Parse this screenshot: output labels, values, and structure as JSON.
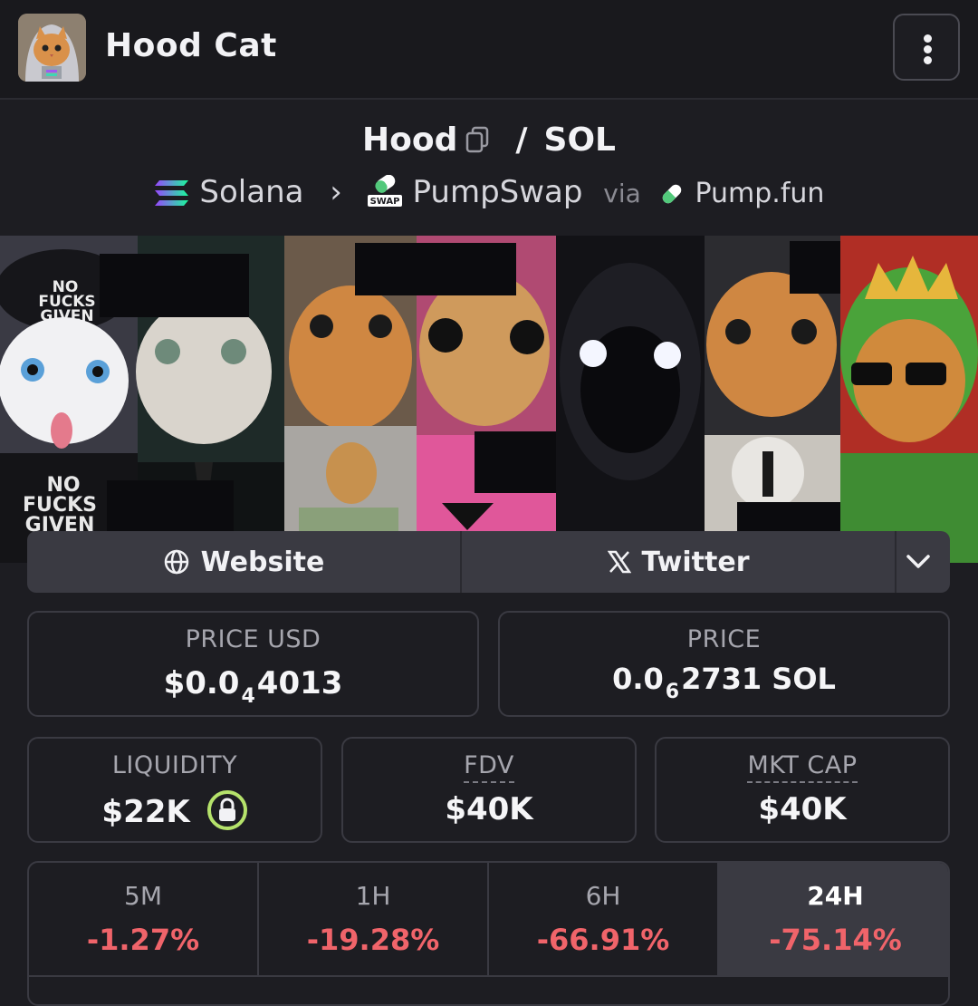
{
  "header": {
    "title": "Hood Cat"
  },
  "pair": {
    "base": "Hood",
    "separator": "/",
    "quote": "SOL"
  },
  "route": {
    "chain": "Solana",
    "dex": "PumpSwap",
    "via": "via",
    "launchpad": "Pump.fun",
    "swap_badge": "SWAP"
  },
  "banner": {
    "cap1_top": "NO",
    "cap1_mid": "FUCKS",
    "cap1_bot": "GIVEN",
    "shirt_top": "NO",
    "shirt_mid": "FUCKS",
    "shirt_bot": "GIVEN"
  },
  "links": {
    "website": "Website",
    "twitter": "Twitter"
  },
  "stats": {
    "price_usd": {
      "label": "PRICE USD",
      "prefix": "$0.0",
      "zeros": "4",
      "digits": "4013"
    },
    "price_sol": {
      "label": "PRICE",
      "prefix": "0.0",
      "zeros": "6",
      "digits": "2731 SOL"
    },
    "liquidity": {
      "label": "LIQUIDITY",
      "value": "$22K"
    },
    "fdv": {
      "label": "FDV",
      "value": "$40K"
    },
    "mkt_cap": {
      "label": "MKT CAP",
      "value": "$40K"
    }
  },
  "changes": [
    {
      "label": "5M",
      "value": "-1.27%"
    },
    {
      "label": "1H",
      "value": "-19.28%"
    },
    {
      "label": "6H",
      "value": "-66.91%"
    },
    {
      "label": "24H",
      "value": "-75.14%"
    }
  ],
  "colors": {
    "negative": "#f0646a",
    "lock_ring": "#b5e26b",
    "bg": "#1d1d22",
    "card_border": "#3a3a42"
  }
}
